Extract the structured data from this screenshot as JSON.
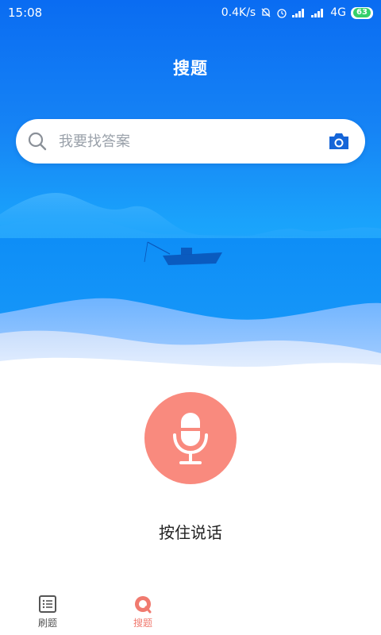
{
  "status_bar": {
    "time": "15:08",
    "network_speed": "0.4K/s",
    "network_type": "4G",
    "battery": "63"
  },
  "header": {
    "title": "搜题"
  },
  "search": {
    "placeholder": "我要找答案",
    "value": ""
  },
  "voice": {
    "hold_label": "按住说话"
  },
  "tabbar": {
    "items": [
      {
        "label": "刷题",
        "active": false,
        "icon": "list-icon"
      },
      {
        "label": "搜题",
        "active": true,
        "icon": "search-tab-icon"
      }
    ]
  },
  "colors": {
    "hero_blue": "#1684f5",
    "mic_accent": "#f98a7e",
    "active_tab": "#f07a6f"
  }
}
